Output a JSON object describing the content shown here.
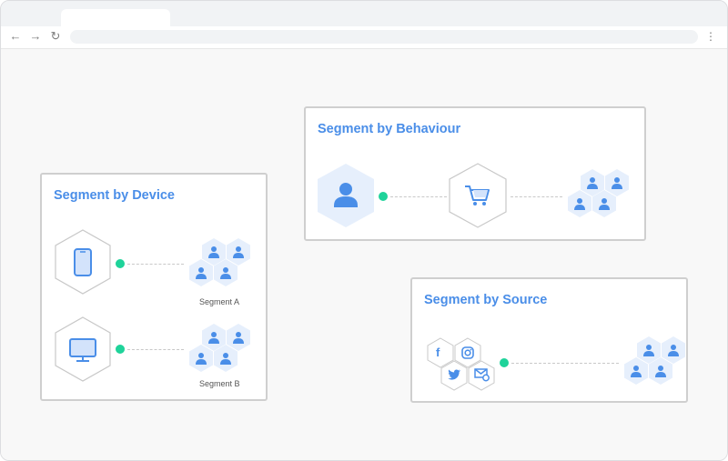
{
  "browser": {
    "back_icon": "arrow-left-icon",
    "forward_icon": "arrow-right-icon",
    "reload_icon": "reload-icon",
    "menu_icon": "more-vertical-icon"
  },
  "cards": {
    "device": {
      "title": "Segment by Device",
      "segment_a_label": "Segment A",
      "segment_b_label": "Segment B"
    },
    "behaviour": {
      "title": "Segment by Behaviour"
    },
    "source": {
      "title": "Segment by Source"
    }
  },
  "icons": [
    "smartphone-icon",
    "monitor-icon",
    "user-icon",
    "shopping-cart-icon",
    "facebook-icon",
    "instagram-icon",
    "twitter-icon",
    "email-icon",
    "audience-segment-icon"
  ],
  "colors": {
    "accent": "#4a8ee8",
    "connector_dot": "#1fd39a",
    "hex_fill": "#e6effc",
    "card_border": "#cfcfcf"
  }
}
